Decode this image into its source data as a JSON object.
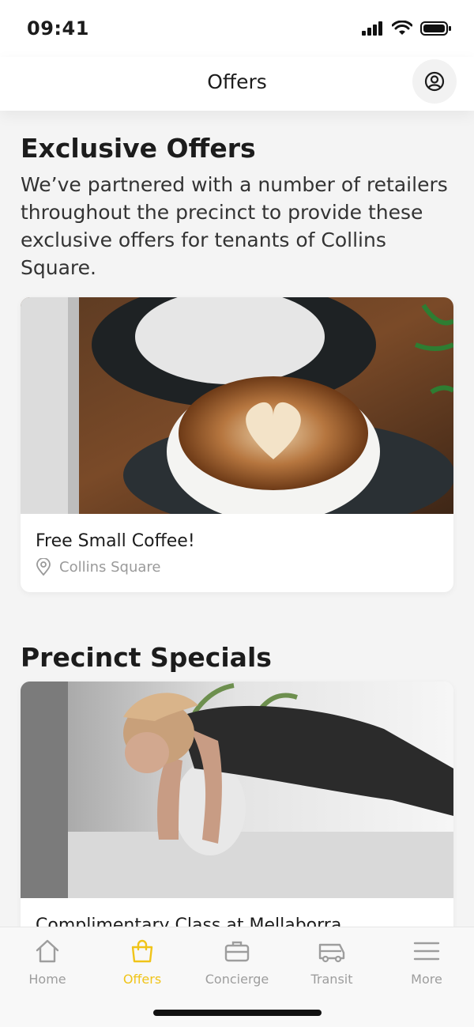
{
  "status": {
    "time": "09:41"
  },
  "header": {
    "title": "Offers"
  },
  "sections": {
    "exclusive": {
      "title": "Exclusive Offers",
      "intro": "We’ve partnered with a number of retailers throughout the precinct to provide these exclusive offers for tenants of Collins Square."
    },
    "precinct": {
      "title": "Precinct Specials"
    }
  },
  "offers": [
    {
      "title": "Free Small Coffee!",
      "location": "Collins Square"
    },
    {
      "title": "Complimentary Class at Mellaborra"
    }
  ],
  "tabs": [
    {
      "label": "Home",
      "icon": "home-icon"
    },
    {
      "label": "Offers",
      "icon": "shopping-bag-icon"
    },
    {
      "label": "Concierge",
      "icon": "briefcase-icon"
    },
    {
      "label": "Transit",
      "icon": "bus-icon"
    },
    {
      "label": "More",
      "icon": "menu-icon"
    }
  ],
  "colors": {
    "accent": "#f0c419",
    "inactive": "#9d9d9d",
    "background": "#f4f4f4"
  }
}
